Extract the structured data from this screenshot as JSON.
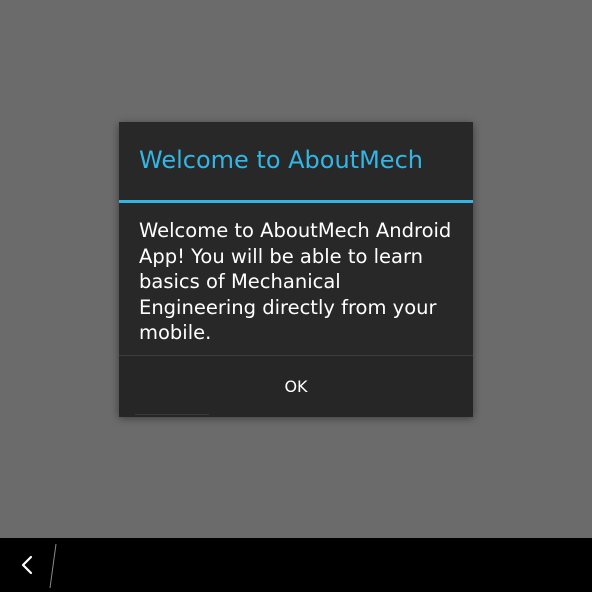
{
  "dialog": {
    "title": "Welcome to AboutMech",
    "message": "Welcome to AboutMech Android App! You will be able to learn basics of Mechanical Engineering directly from your mobile.",
    "ok_label": "OK"
  },
  "colors": {
    "accent": "#33b5e5",
    "dialog_background": "#282828",
    "screen_dim": "#6b6b6b",
    "nav_bar": "#000000"
  },
  "nav": {
    "back_icon": "back-chevron-icon"
  }
}
